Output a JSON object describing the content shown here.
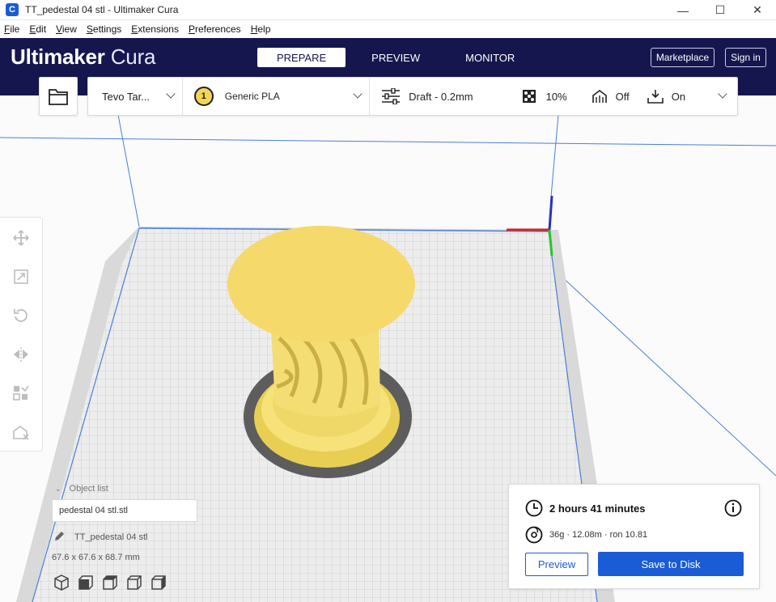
{
  "window": {
    "title": "TT_pedestal 04 stl - Ultimaker Cura",
    "app_icon": "C",
    "minimize": "—",
    "maximize": "☐",
    "close": "✕"
  },
  "menu": {
    "items": [
      {
        "u": "F",
        "rest": "ile"
      },
      {
        "u": "E",
        "rest": "dit"
      },
      {
        "u": "V",
        "rest": "iew"
      },
      {
        "u": "S",
        "rest": "ettings"
      },
      {
        "u": "E",
        "rest": "xtensions"
      },
      {
        "u": "P",
        "rest": "references"
      },
      {
        "u": "H",
        "rest": "elp"
      }
    ]
  },
  "header": {
    "brand_bold": "Ultimaker",
    "brand_light": " Cura",
    "tabs": [
      "PREPARE",
      "PREVIEW",
      "MONITOR"
    ],
    "marketplace": "Marketplace",
    "signin": "Sign in"
  },
  "toolbar": {
    "printer": "Tevo Tar...",
    "extruder_number": "1",
    "material": "Generic PLA",
    "profile": "Draft - 0.2mm",
    "infill": "10%",
    "support": "Off",
    "adhesion": "On"
  },
  "object": {
    "toggle_label": "Object list",
    "field_value": "pedestal 04 stl.stl",
    "name": "TT_pedestal 04 stl",
    "dimensions": "67.6 x 67.6 x 68.7 mm"
  },
  "print": {
    "time": "2 hours 41 minutes",
    "material_info": "36g · 12.08m · ron 10.81",
    "preview": "Preview",
    "save": "Save to Disk"
  },
  "colors": {
    "header_bg": "#16164f",
    "accent": "#1a5bd6",
    "model_yellow": "#f5dc6e"
  }
}
